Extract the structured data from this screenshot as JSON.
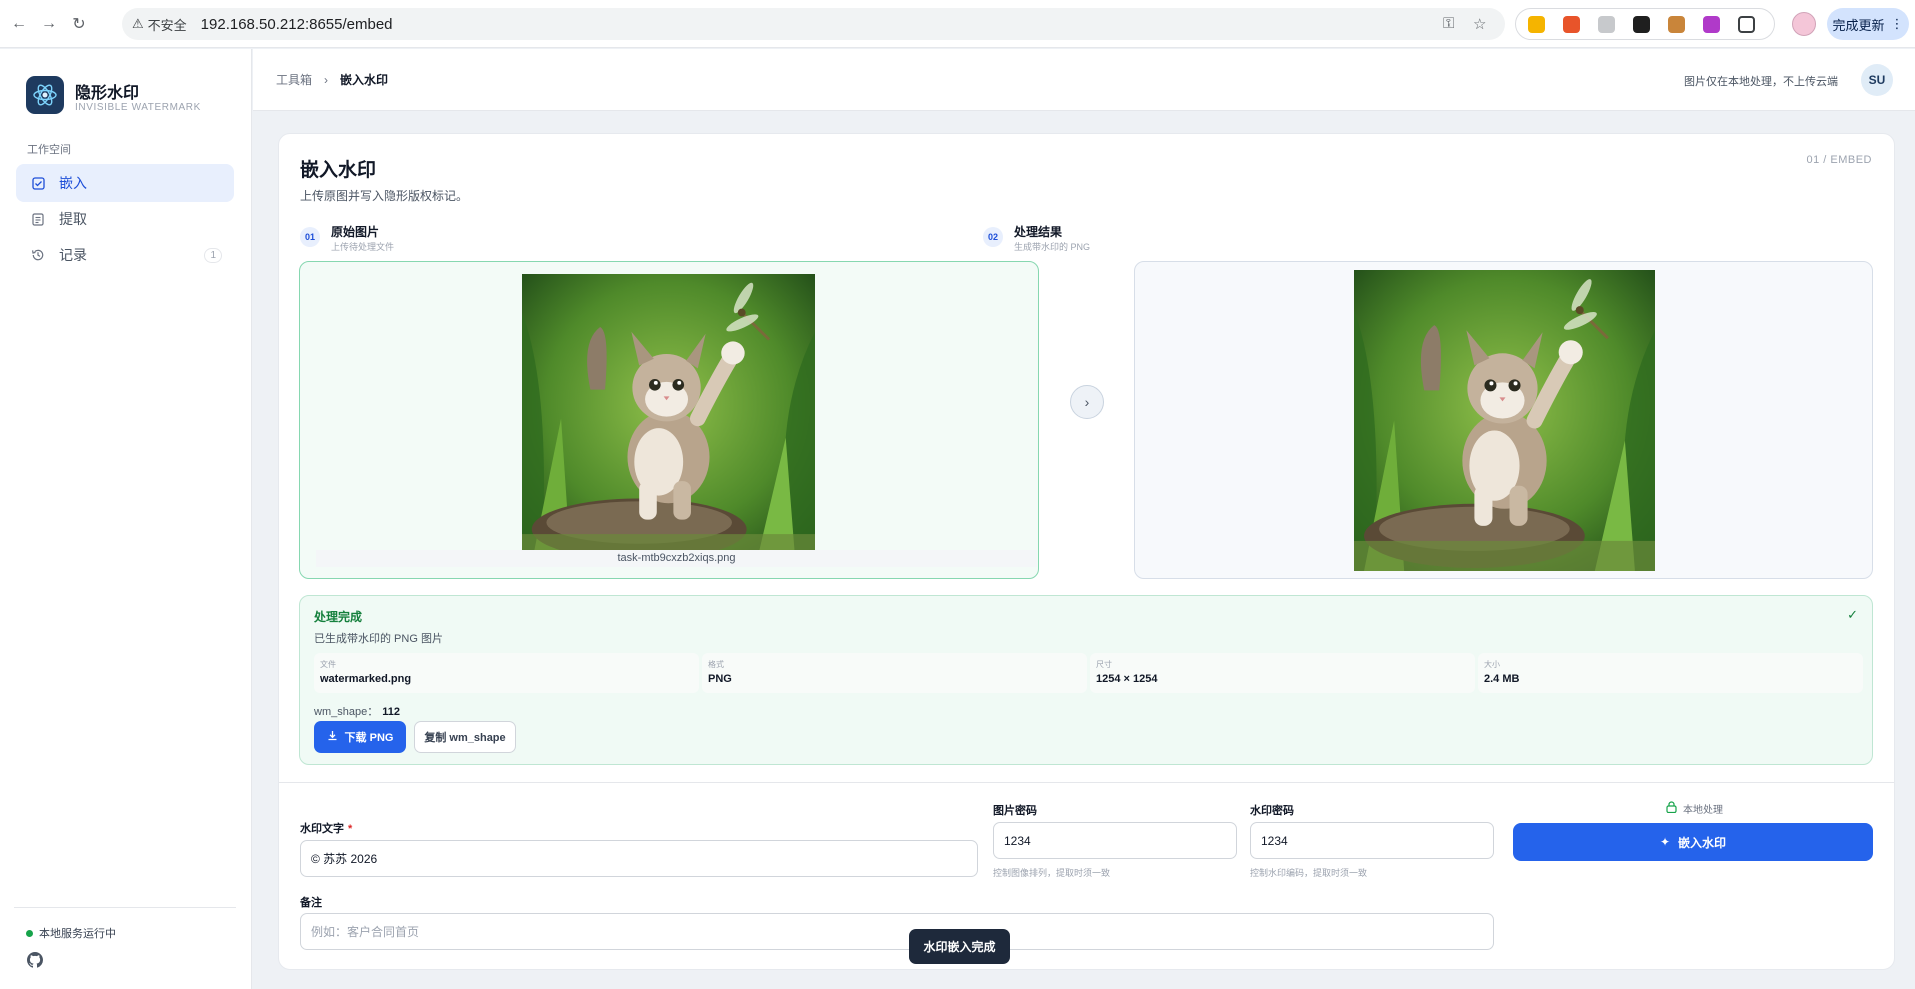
{
  "browser": {
    "security_label": "不安全",
    "url": "192.168.50.212:8655/embed",
    "update_label": "完成更新"
  },
  "sidebar": {
    "brand_title": "隐形水印",
    "brand_subtitle": "INVISIBLE WATERMARK",
    "section_label": "工作空间",
    "items": [
      {
        "label": "嵌入",
        "icon": "check-square-icon",
        "active": true
      },
      {
        "label": "提取",
        "icon": "document-icon",
        "active": false
      },
      {
        "label": "记录",
        "icon": "history-icon",
        "active": false,
        "count": "1"
      }
    ],
    "status_text": "本地服务运行中"
  },
  "header": {
    "breadcrumb": [
      "工具箱",
      "嵌入水印"
    ],
    "local_note": "图片仅在本地处理，不上传云端",
    "avatar": "SU"
  },
  "page": {
    "title": "嵌入水印",
    "subtitle": "上传原图并写入隐形版权标记。",
    "step_code": "01 / EMBED"
  },
  "steps": [
    {
      "num": "01",
      "title": "原始图片",
      "desc": "上传待处理文件",
      "filename": "task-mtb9cxzb2xiqs.png"
    },
    {
      "num": "02",
      "title": "处理结果",
      "desc": "生成带水印的 PNG"
    }
  ],
  "result": {
    "title": "处理完成",
    "subtitle": "已生成带水印的 PNG 图片",
    "meta": [
      {
        "key": "文件",
        "value": "watermarked.png"
      },
      {
        "key": "格式",
        "value": "PNG"
      },
      {
        "key": "尺寸",
        "value": "1254 × 1254"
      },
      {
        "key": "大小",
        "value": "2.4 MB"
      }
    ],
    "wm_shape_label": "wm_shape：",
    "wm_shape_value": "112",
    "download_label": "下载 PNG",
    "copy_label": "复制 wm_shape"
  },
  "form": {
    "watermark_text_label": "水印文字",
    "watermark_text_value": "© 苏苏 2026",
    "image_pwd_label": "图片密码",
    "image_pwd_value": "1234",
    "image_pwd_hint": "控制图像排列，提取时须一致",
    "wm_pwd_label": "水印密码",
    "wm_pwd_value": "1234",
    "wm_pwd_hint": "控制水印编码，提取时须一致",
    "note_label": "备注",
    "note_placeholder": "例如：客户合同首页",
    "local_label": "本地处理",
    "embed_label": "嵌入水印"
  },
  "toast": "水印嵌入完成",
  "colors": {
    "accent": "#2563eb",
    "success": "#15803d",
    "success_bg": "#f0faf5"
  }
}
